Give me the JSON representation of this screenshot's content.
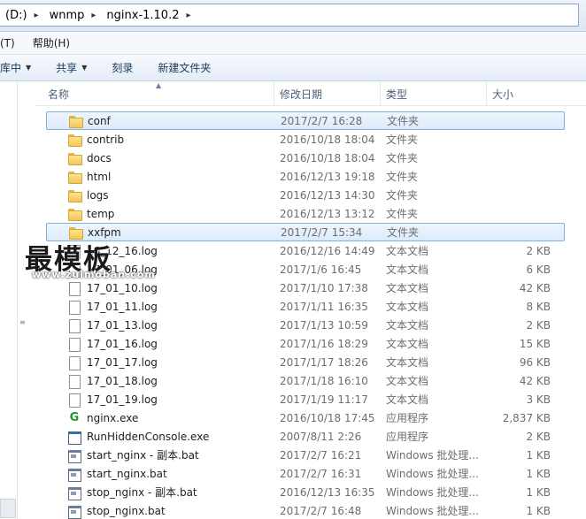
{
  "address": {
    "crumbs": [
      "(D:)",
      "wnmp",
      "nginx-1.10.2"
    ]
  },
  "menu": {
    "items": [
      "(T)",
      "帮助(H)"
    ]
  },
  "toolbar": {
    "library_label": "库中",
    "share_label": "共享",
    "burn_label": "刻录",
    "new_folder_label": "新建文件夹"
  },
  "columns": {
    "name": "名称",
    "date": "修改日期",
    "type": "类型",
    "size": "大小"
  },
  "files": [
    {
      "name": "conf",
      "date": "2017/2/7 16:28",
      "type": "文件夹",
      "size": "",
      "icon": "folder-icon",
      "selected": true
    },
    {
      "name": "contrib",
      "date": "2016/10/18 18:04",
      "type": "文件夹",
      "size": "",
      "icon": "folder-icon",
      "selected": false
    },
    {
      "name": "docs",
      "date": "2016/10/18 18:04",
      "type": "文件夹",
      "size": "",
      "icon": "folder-icon",
      "selected": false
    },
    {
      "name": "html",
      "date": "2016/12/13 19:18",
      "type": "文件夹",
      "size": "",
      "icon": "folder-icon",
      "selected": false
    },
    {
      "name": "logs",
      "date": "2016/12/13 14:30",
      "type": "文件夹",
      "size": "",
      "icon": "folder-icon",
      "selected": false
    },
    {
      "name": "temp",
      "date": "2016/12/13 13:12",
      "type": "文件夹",
      "size": "",
      "icon": "folder-icon",
      "selected": false
    },
    {
      "name": "xxfpm",
      "date": "2017/2/7 15:34",
      "type": "文件夹",
      "size": "",
      "icon": "folder-icon",
      "selected": true
    },
    {
      "name": "16_12_16.log",
      "date": "2016/12/16 14:49",
      "type": "文本文档",
      "size": "2 KB",
      "icon": "document-icon",
      "selected": false
    },
    {
      "name": "17_01_06.log",
      "date": "2017/1/6 16:45",
      "type": "文本文档",
      "size": "6 KB",
      "icon": "document-icon",
      "selected": false
    },
    {
      "name": "17_01_10.log",
      "date": "2017/1/10 17:38",
      "type": "文本文档",
      "size": "42 KB",
      "icon": "document-icon",
      "selected": false
    },
    {
      "name": "17_01_11.log",
      "date": "2017/1/11 16:35",
      "type": "文本文档",
      "size": "8 KB",
      "icon": "document-icon",
      "selected": false
    },
    {
      "name": "17_01_13.log",
      "date": "2017/1/13 10:59",
      "type": "文本文档",
      "size": "2 KB",
      "icon": "document-icon",
      "selected": false
    },
    {
      "name": "17_01_16.log",
      "date": "2017/1/16 18:29",
      "type": "文本文档",
      "size": "15 KB",
      "icon": "document-icon",
      "selected": false
    },
    {
      "name": "17_01_17.log",
      "date": "2017/1/17 18:26",
      "type": "文本文档",
      "size": "96 KB",
      "icon": "document-icon",
      "selected": false
    },
    {
      "name": "17_01_18.log",
      "date": "2017/1/18 16:10",
      "type": "文本文档",
      "size": "42 KB",
      "icon": "document-icon",
      "selected": false
    },
    {
      "name": "17_01_19.log",
      "date": "2017/1/19 11:17",
      "type": "文本文档",
      "size": "3 KB",
      "icon": "document-icon",
      "selected": false
    },
    {
      "name": "nginx.exe",
      "date": "2016/10/18 17:45",
      "type": "应用程序",
      "size": "2,837 KB",
      "icon": "nginx-app-icon",
      "selected": false
    },
    {
      "name": "RunHiddenConsole.exe",
      "date": "2007/8/11 2:26",
      "type": "应用程序",
      "size": "2 KB",
      "icon": "application-icon",
      "selected": false
    },
    {
      "name": "start_nginx - 副本.bat",
      "date": "2017/2/7 16:21",
      "type": "Windows 批处理...",
      "size": "1 KB",
      "icon": "batch-file-icon",
      "selected": false
    },
    {
      "name": "start_nginx.bat",
      "date": "2017/2/7 16:31",
      "type": "Windows 批处理...",
      "size": "1 KB",
      "icon": "batch-file-icon",
      "selected": false
    },
    {
      "name": "stop_nginx - 副本.bat",
      "date": "2016/12/13 16:35",
      "type": "Windows 批处理...",
      "size": "1 KB",
      "icon": "batch-file-icon",
      "selected": false
    },
    {
      "name": "stop_nginx.bat",
      "date": "2017/2/7 16:48",
      "type": "Windows 批处理...",
      "size": "1 KB",
      "icon": "batch-file-icon",
      "selected": false
    }
  ],
  "watermark": {
    "title": "最模板",
    "url": "www.zuimoban.com"
  }
}
